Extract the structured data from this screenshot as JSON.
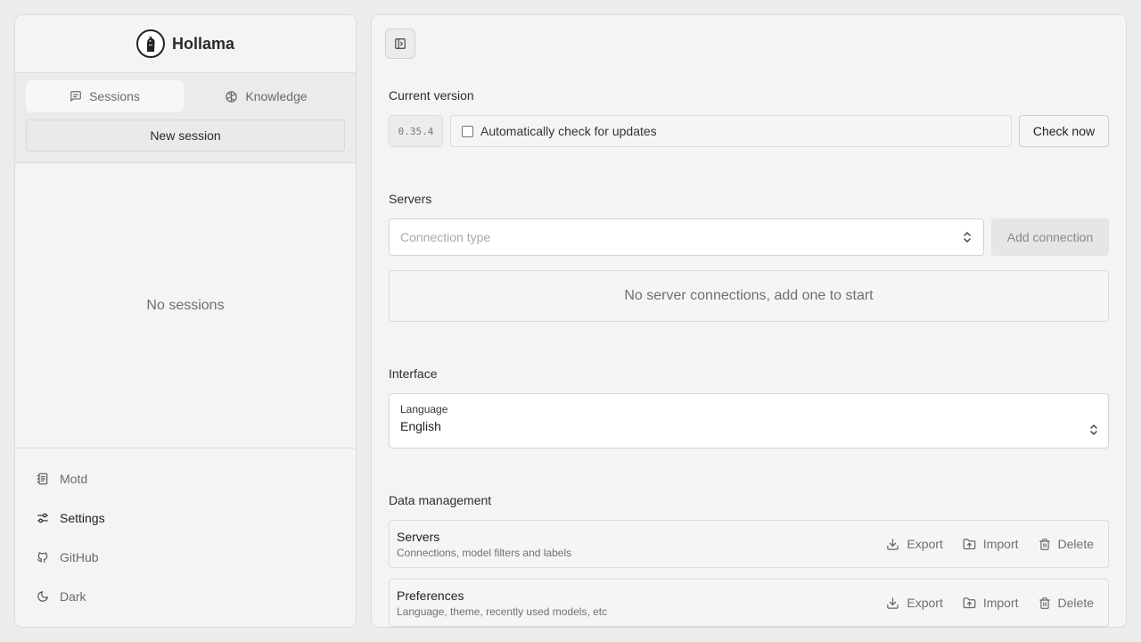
{
  "app": {
    "name": "Hollama",
    "logo_icon": "llama-logo-icon"
  },
  "sidebar": {
    "tabs": [
      {
        "label": "Sessions",
        "icon": "message-square-icon",
        "active": true
      },
      {
        "label": "Knowledge",
        "icon": "brain-icon",
        "active": false
      }
    ],
    "new_session_label": "New session",
    "empty_text": "No sessions",
    "nav": [
      {
        "label": "Motd",
        "icon": "newspaper-icon"
      },
      {
        "label": "Settings",
        "icon": "sliders-icon",
        "active": true
      },
      {
        "label": "GitHub",
        "icon": "github-icon"
      },
      {
        "label": "Dark",
        "icon": "moon-icon"
      }
    ]
  },
  "settings": {
    "current_version": {
      "heading": "Current version",
      "version": "0.35.4",
      "auto_check_label": "Automatically check for updates",
      "auto_check_checked": false,
      "check_now_label": "Check now"
    },
    "servers": {
      "heading": "Servers",
      "connection_placeholder": "Connection type",
      "add_connection_label": "Add connection",
      "empty_text": "No server connections, add one to start"
    },
    "interface": {
      "heading": "Interface",
      "language_label": "Language",
      "language_value": "English"
    },
    "data_management": {
      "heading": "Data management",
      "rows": [
        {
          "title": "Servers",
          "description": "Connections, model filters and labels"
        },
        {
          "title": "Preferences",
          "description": "Language, theme, recently used models, etc"
        }
      ],
      "actions": {
        "export": "Export",
        "import": "Import",
        "delete": "Delete"
      }
    }
  }
}
